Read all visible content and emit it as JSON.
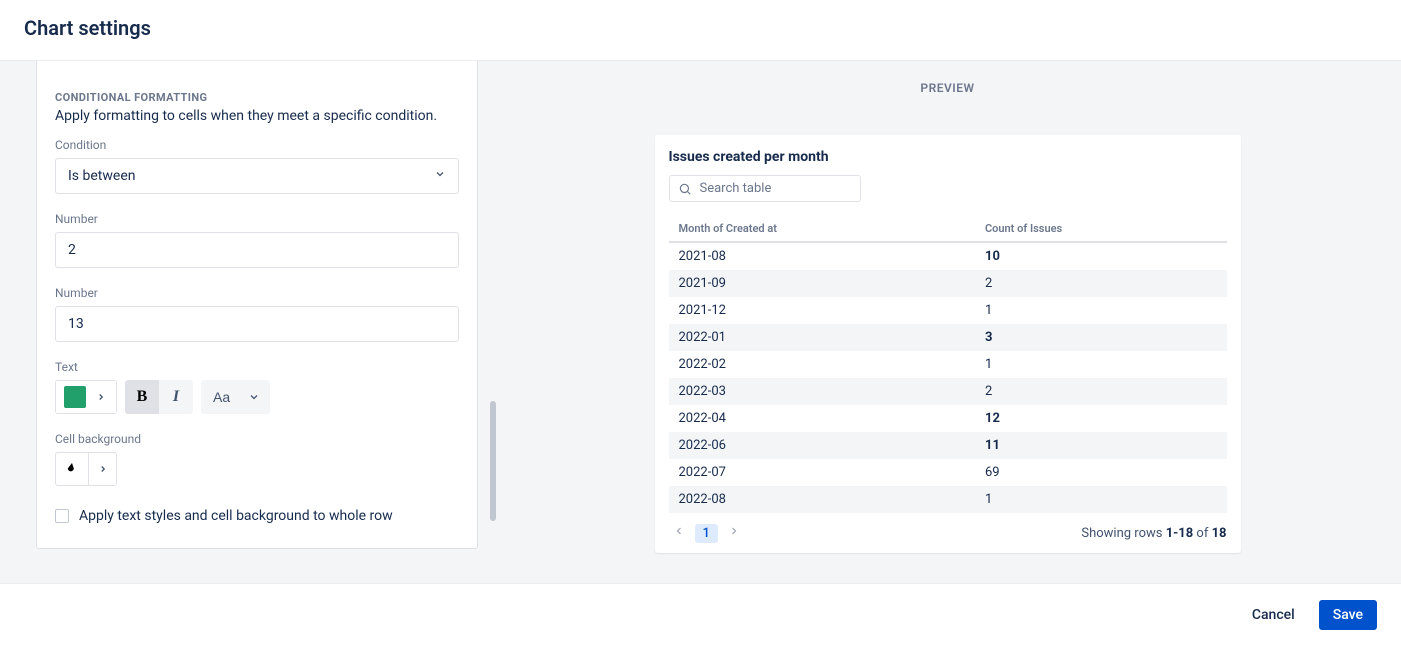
{
  "header": {
    "title": "Chart settings"
  },
  "panel": {
    "section_heading": "CONDITIONAL FORMATTING",
    "section_desc": "Apply formatting to cells when they meet a specific condition.",
    "condition_label": "Condition",
    "condition_value": "Is between",
    "number1_label": "Number",
    "number1_value": "2",
    "number2_label": "Number",
    "number2_value": "13",
    "text_label": "Text",
    "text_color": "#22A06B",
    "aa_label": "Aa",
    "cellbg_label": "Cell background",
    "wholerow_label": "Apply text styles and cell background to whole row"
  },
  "preview": {
    "label": "PREVIEW",
    "chart_title": "Issues created per month",
    "search_placeholder": "Search table",
    "columns": [
      "Month of Created at",
      "Count of Issues"
    ],
    "rows": [
      {
        "month": "2021-08",
        "count": "10",
        "hl": true
      },
      {
        "month": "2021-09",
        "count": "2",
        "hl": false
      },
      {
        "month": "2021-12",
        "count": "1",
        "hl": false
      },
      {
        "month": "2022-01",
        "count": "3",
        "hl": true
      },
      {
        "month": "2022-02",
        "count": "1",
        "hl": false
      },
      {
        "month": "2022-03",
        "count": "2",
        "hl": false
      },
      {
        "month": "2022-04",
        "count": "12",
        "hl": true
      },
      {
        "month": "2022-06",
        "count": "11",
        "hl": true
      },
      {
        "month": "2022-07",
        "count": "69",
        "hl": false
      },
      {
        "month": "2022-08",
        "count": "1",
        "hl": false
      }
    ],
    "page_num": "1",
    "rows_info_prefix": "Showing rows ",
    "rows_info_range": "1-18",
    "rows_info_of": " of ",
    "rows_info_total": "18"
  },
  "footer": {
    "cancel": "Cancel",
    "save": "Save"
  },
  "chart_data": {
    "type": "table",
    "title": "Issues created per month",
    "columns": [
      "Month of Created at",
      "Count of Issues"
    ],
    "rows": [
      [
        "2021-08",
        10
      ],
      [
        "2021-09",
        2
      ],
      [
        "2021-12",
        1
      ],
      [
        "2022-01",
        3
      ],
      [
        "2022-02",
        1
      ],
      [
        "2022-03",
        2
      ],
      [
        "2022-04",
        12
      ],
      [
        "2022-06",
        11
      ],
      [
        "2022-07",
        69
      ],
      [
        "2022-08",
        1
      ]
    ],
    "total_rows": 18,
    "visible_range": [
      1,
      18
    ],
    "conditional_format": {
      "column": "Count of Issues",
      "condition": "Is between",
      "min": 2,
      "max": 13,
      "text_color": "#00875A",
      "bold": true
    }
  }
}
